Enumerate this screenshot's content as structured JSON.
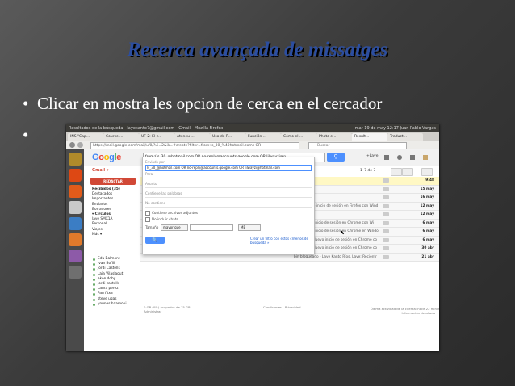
{
  "slide": {
    "title": "Recerca avançada de missatges",
    "bullets": [
      "Clicar en mostra les opcion de cerca en el cercador",
      ""
    ],
    "bullet_glyph": "•"
  },
  "browser": {
    "title": "Resultados de la búsqueda - layekanto7@gmail.com - Gmail - Mozilla Firefox",
    "status_right": "mar 19 de may 12:17  Juan Pablo Vargas",
    "tabs": [
      "INS \"Cap...",
      "Course ...",
      "UF 2: El c...",
      "Ateneu ...",
      "Uso de R...",
      "Función ...",
      "Cómo el ...",
      "Photo e...",
      "Result...",
      "Traduct..."
    ],
    "url": "https://mail.google.com/mail/u/0/?ui=2&ik=#create?filter=from:ls_30_%40hotmail.com+OR",
    "search_placeholder": "Buscar"
  },
  "gmail": {
    "logo": "Google",
    "search_query": "from:(ls_30_@hotmail.com OR no-reply@accounts.google.com OR lilwayzi@p",
    "gmail_label": "Gmail ▾",
    "compose": "REDACTAR",
    "user": "+Laye",
    "folders": [
      {
        "label": "Recibidos (35)",
        "bold": true
      },
      {
        "label": "Destacados",
        "bold": false
      },
      {
        "label": "Importantes",
        "bold": false
      },
      {
        "label": "Enviados",
        "bold": false
      },
      {
        "label": "Borradores",
        "bold": false
      },
      {
        "label": "▾ Círculos",
        "bold": true
      },
      {
        "label": "laye SMX1A",
        "bold": false
      },
      {
        "label": "Personal",
        "bold": false
      },
      {
        "label": "Viajes",
        "bold": false
      },
      {
        "label": "Más ▾",
        "bold": false
      }
    ],
    "contacts": [
      "Edu Balmont",
      "Ivan Bofill",
      "Jordi Castells",
      "Laia Vilaslagut",
      "akon doby",
      "jordi castells",
      "Laura perez",
      "Pau fitxa",
      "steve ugas",
      "younes haamoui"
    ],
    "pager": "1–7 de 7",
    "rows": [
      {
        "snippet": "",
        "date": "9:48"
      },
      {
        "snippet": "",
        "date": "15 may"
      },
      {
        "snippet": "",
        "date": "16 may"
      },
      {
        "snippet": "ows - Nuevo inicio de sesión en Firefox con Wind",
        "date": "12 may"
      },
      {
        "snippet": "",
        "date": "12 may"
      },
      {
        "snippet": "ws - Nuevo inicio de sesión en Chrome con Wi",
        "date": "6 may"
      },
      {
        "snippet": "ws - Nuevo inicio de sesión en Chrome en Windo",
        "date": "6 may"
      },
      {
        "snippet": "Windows - Nuevo inicio de sesión en Chrome co",
        "date": "6 may"
      },
      {
        "snippet": "Windows - Nuevo inicio de sesión en Chrome co",
        "date": "30 abr"
      },
      {
        "snippet": "bin bloqueado - Laye Kanto Ríos, Laye: Recientr",
        "date": "21 abr"
      }
    ],
    "footer_left": "0 GB (0%) ocupados de 15 GB\nAdministrar",
    "footer_mid": "Condiciones - Privacidad",
    "footer_right": "Última actividad de la cuenta: hace 22 minutos\nInformación detallada",
    "panel": {
      "from_label": "Enviado por",
      "from_value": "ls_30_@hotmail.com OR no-reply@accounts.google.com OR lilwayzi@hotmail.com",
      "to_label": "Para",
      "subject_label": "Asunto",
      "has_words": "Contiene las palabras",
      "no_has": "No contiene",
      "attachments": "Contiene archivos adjuntos",
      "no_chats": "No incluir chats",
      "size_label": "Tamaño",
      "size_op": "mayor que",
      "size_unit": "MB",
      "create_filter": "Crear un filtro con estos criterios de búsqueda »",
      "search_btn": "🔍"
    }
  },
  "colors": {
    "title_blue": "#2c4ea0",
    "gmail_red": "#d14836",
    "gmail_blue": "#4d90fe"
  }
}
